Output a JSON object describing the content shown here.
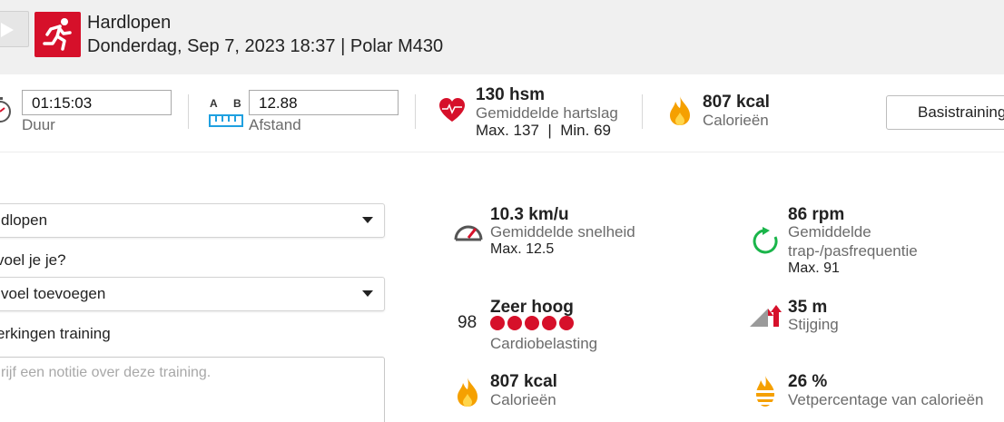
{
  "header": {
    "title": "Hardlopen",
    "subtitle": "Donderdag, Sep 7, 2023 18:37 | Polar M430"
  },
  "summary": {
    "duration_value": "01:15:03",
    "duration_label": "Duur",
    "distance_a": "A",
    "distance_b": "B",
    "distance_value": "12.88",
    "distance_label": "Afstand",
    "heartrate_value": "130 hsm",
    "heartrate_label": "Gemiddelde hartslag",
    "heartrate_minmax": "Max. 137  |  Min. 69",
    "calories_value": "807 kcal",
    "calories_label": "Calorieën",
    "basis_button": "Basistraining",
    "colors": {
      "heart": "#d6102a",
      "flame": "#f5a000"
    }
  },
  "form": {
    "sport_select": "dlopen",
    "feel_label": "voel je je?",
    "feel_select": "voel toevoegen",
    "notes_label": "erkingen training",
    "notes_placeholder": "rijf een notitie over deze training."
  },
  "stats": {
    "speed_value": "10.3 km/u",
    "speed_label": "Gemiddelde snelheid",
    "speed_max": "Max. 12.5",
    "cadence_value": "86 rpm",
    "cadence_label_1": "Gemiddelde",
    "cadence_label_2": "trap-/pasfrequentie",
    "cadence_max": "Max. 91",
    "load_number": "98",
    "load_value": "Zeer hoog",
    "load_dots": 5,
    "load_label": "Cardiobelasting",
    "ascent_value": "35 m",
    "ascent_label": "Stijging",
    "calories_value": "807 kcal",
    "calories_label": "Calorieën",
    "fat_value": "26 %",
    "fat_label": "Vetpercentage van calorieën"
  }
}
